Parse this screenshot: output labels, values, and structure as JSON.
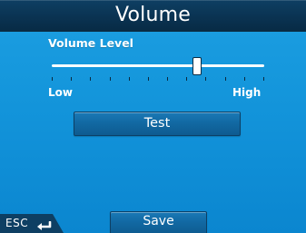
{
  "window": {
    "title": "Volume"
  },
  "volume": {
    "label": "Volume Level",
    "low_label": "Low",
    "high_label": "High",
    "level_fraction": 0.68,
    "tick_count": 12
  },
  "buttons": {
    "test_label": "Test",
    "save_label": "Save",
    "esc_label": "ESC"
  },
  "icons": {
    "back": "return-arrow-icon"
  },
  "colors": {
    "background": "#1597dc",
    "titlebar": "#0a3352",
    "button": "#1269a3",
    "text": "#ffffff"
  }
}
